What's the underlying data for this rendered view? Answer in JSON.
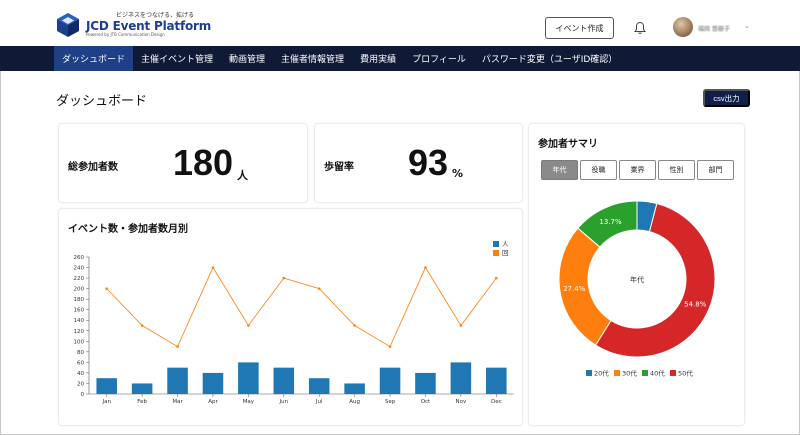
{
  "header": {
    "logo_tagline": "ビジネスをつなげる、拡げる",
    "logo_name": "JCD Event Platform",
    "logo_sub": "Powered by JTB Communication Design",
    "create_event_label": "イベント作成",
    "user_name": "福岡 悠樹子",
    "user_caret": "⌄"
  },
  "nav": {
    "items": [
      {
        "label": "ダッシュボード",
        "active": true
      },
      {
        "label": "主催イベント管理"
      },
      {
        "label": "動画管理"
      },
      {
        "label": "主催者情報管理"
      },
      {
        "label": "費用実績"
      },
      {
        "label": "プロフィール"
      },
      {
        "label": "パスワード変更（ユーザID確認）"
      }
    ]
  },
  "page": {
    "title": "ダッシュボード",
    "csv_label": "csv出力"
  },
  "stats": {
    "total_label": "総参加者数",
    "total_value": "180",
    "total_unit": "人",
    "retention_label": "歩留率",
    "retention_value": "93",
    "retention_unit": "%"
  },
  "events_chart_title": "イベント数・参加者数月別",
  "summary": {
    "title": "参加者サマリ",
    "tabs": [
      {
        "label": "年代",
        "active": true
      },
      {
        "label": "役職"
      },
      {
        "label": "業界"
      },
      {
        "label": "性別"
      },
      {
        "label": "部門"
      }
    ]
  },
  "chart_data": [
    {
      "type": "bar",
      "title": "イベント数・参加者数月別",
      "categories": [
        "Jan",
        "Feb",
        "Mar",
        "Apr",
        "May",
        "Jun",
        "Jul",
        "Aug",
        "Sep",
        "Oct",
        "Nov",
        "Dec"
      ],
      "series": [
        {
          "name": "人",
          "kind": "bar",
          "color": "#1f77b4",
          "values": [
            30,
            20,
            50,
            40,
            60,
            50,
            30,
            20,
            50,
            40,
            60,
            50
          ]
        },
        {
          "name": "回",
          "kind": "line",
          "color": "#ff7f0e",
          "values": [
            200,
            130,
            90,
            240,
            130,
            220,
            200,
            130,
            90,
            240,
            130,
            220
          ]
        }
      ],
      "ylim": [
        0,
        260
      ],
      "yticks": [
        0,
        20,
        40,
        60,
        80,
        100,
        120,
        140,
        160,
        180,
        200,
        220,
        240,
        260
      ],
      "grid": false,
      "legend": "top-right"
    },
    {
      "type": "pie",
      "center_label": "年代",
      "slices": [
        {
          "name": "20代",
          "value": 4.1,
          "color": "#1f77b4",
          "label": ""
        },
        {
          "name": "50代",
          "value": 54.8,
          "color": "#d62728",
          "label": "54.8%"
        },
        {
          "name": "30代",
          "value": 27.4,
          "color": "#ff7f0e",
          "label": "27.4%"
        },
        {
          "name": "40代",
          "value": 13.7,
          "color": "#2ca02c",
          "label": "13.7%"
        }
      ],
      "legend": "bottom",
      "legend_order": [
        "20代",
        "30代",
        "40代",
        "50代"
      ]
    }
  ]
}
